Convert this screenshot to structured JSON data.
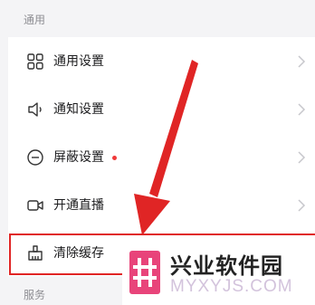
{
  "sections": {
    "general_header": "通用",
    "service_header": "服务"
  },
  "settings": {
    "items": [
      {
        "label": "通用设置",
        "icon": "grid-icon"
      },
      {
        "label": "通知设置",
        "icon": "speaker-icon"
      },
      {
        "label": "屏蔽设置",
        "icon": "block-icon",
        "badge": "red-dot"
      },
      {
        "label": "开通直播",
        "icon": "video-camera-icon"
      },
      {
        "label": "清除缓存",
        "icon": "broom-icon",
        "highlighted": true
      }
    ]
  },
  "annotation": {
    "color": "#e02525"
  },
  "watermark": {
    "title": "兴业软件园",
    "url": "MYXYJS.COM",
    "logo_color": "#e8447a"
  }
}
